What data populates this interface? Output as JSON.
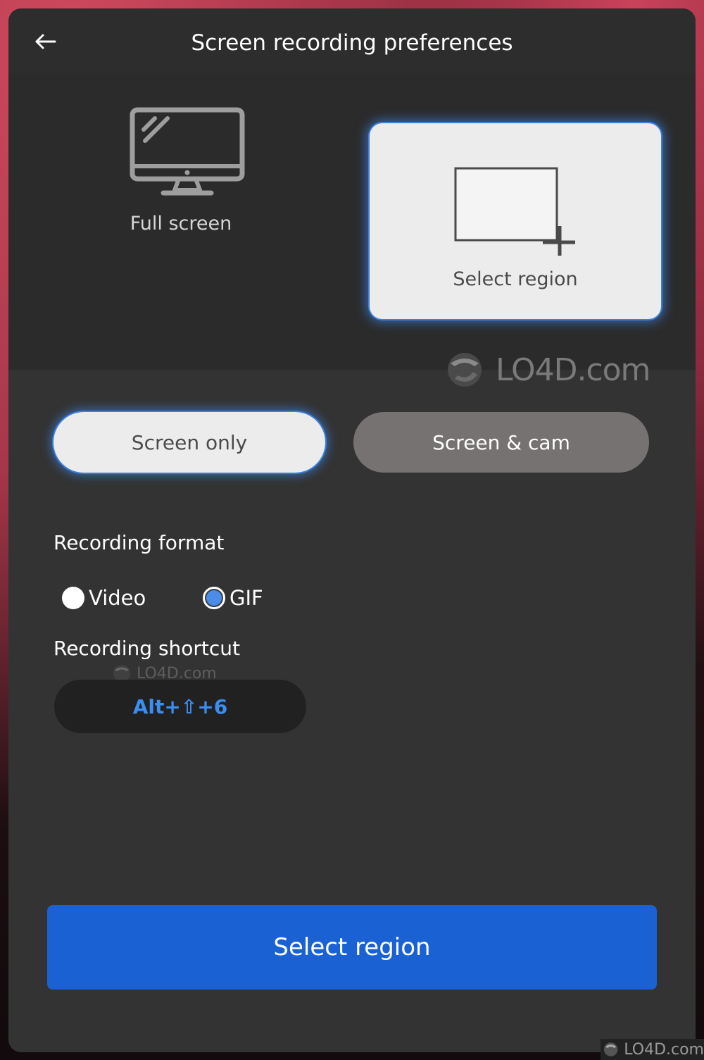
{
  "header": {
    "title": "Screen recording preferences",
    "back_icon": "arrow-left-icon"
  },
  "modes": {
    "full_screen": {
      "label": "Full screen",
      "icon": "monitor-icon",
      "selected": false
    },
    "select_region": {
      "label": "Select region",
      "icon": "region-select-icon",
      "selected": true
    }
  },
  "sources": {
    "screen_only": {
      "label": "Screen only",
      "selected": true
    },
    "screen_cam": {
      "label": "Screen & cam",
      "selected": false
    }
  },
  "recording_format": {
    "label": "Recording format",
    "options": [
      {
        "label": "Video",
        "selected": false
      },
      {
        "label": "GIF",
        "selected": true
      }
    ]
  },
  "recording_shortcut": {
    "label": "Recording shortcut",
    "value": "Alt+⇧+6"
  },
  "primary_action": {
    "label": "Select region"
  },
  "watermarks": {
    "main": "LO4D.com",
    "small": "LO4D.com",
    "corner": "LO4D.com"
  },
  "colors": {
    "accent": "#1a61d3",
    "glow": "#3d7fd9",
    "shortcut": "#3b8ef0",
    "radio_selected": "#4b8ce8"
  }
}
